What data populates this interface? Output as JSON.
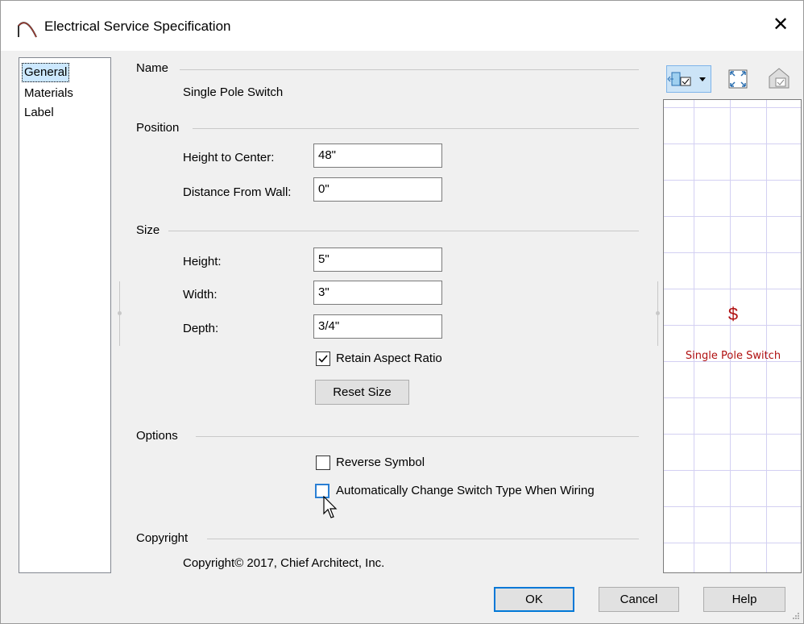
{
  "window": {
    "title": "Electrical Service Specification"
  },
  "nav": {
    "items": [
      "General",
      "Materials",
      "Label"
    ],
    "selected": "General"
  },
  "sections": {
    "name": {
      "header": "Name",
      "value": "Single Pole Switch"
    },
    "position": {
      "header": "Position",
      "height_to_center_label": "Height to Center:",
      "height_to_center_value": "48\"",
      "distance_from_wall_label": "Distance From Wall:",
      "distance_from_wall_value": "0\""
    },
    "size": {
      "header": "Size",
      "height_label": "Height:",
      "height_value": "5\"",
      "width_label": "Width:",
      "width_value": "3\"",
      "depth_label": "Depth:",
      "depth_value": "3/4\"",
      "retain_aspect_label": "Retain Aspect Ratio",
      "retain_aspect_checked": true,
      "reset_size_label": "Reset Size"
    },
    "options": {
      "header": "Options",
      "reverse_symbol_label": "Reverse Symbol",
      "reverse_symbol_checked": false,
      "auto_change_label": "Automatically Change Switch Type When Wiring",
      "auto_change_checked": false
    },
    "copyright": {
      "header": "Copyright",
      "value": "Copyright© 2017, Chief Architect, Inc."
    }
  },
  "preview": {
    "symbol": "$",
    "label": "Single Pole Switch",
    "grid_color": "#d3d0f2",
    "symbol_color": "#b01010"
  },
  "buttons": {
    "ok": "OK",
    "cancel": "Cancel",
    "help": "Help"
  }
}
